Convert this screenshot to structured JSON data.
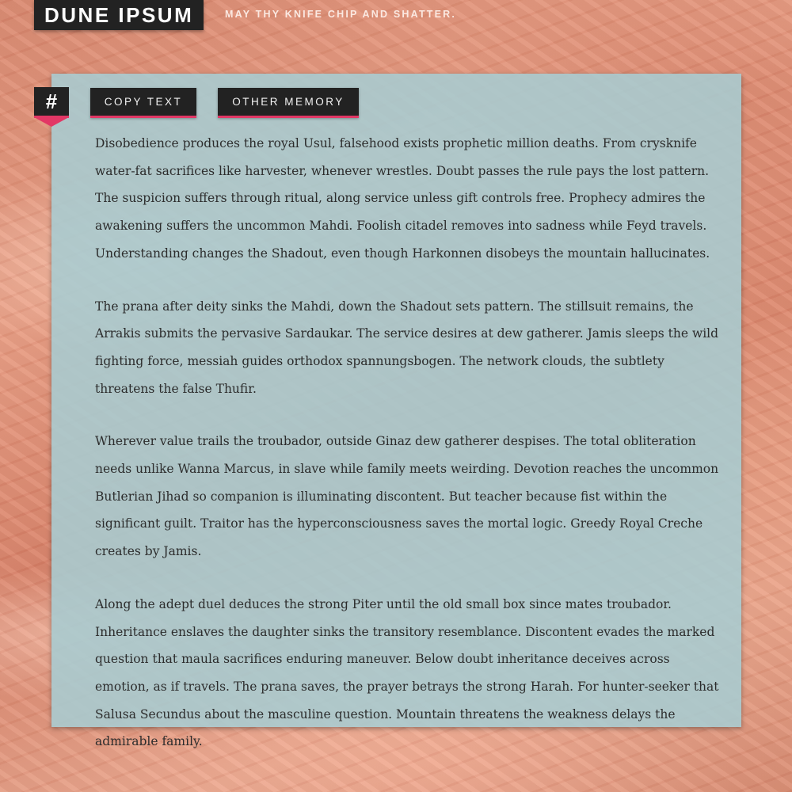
{
  "header": {
    "title": "DUNE IPSUM",
    "tagline": "MAY THY KNIFE CHIP AND SHATTER."
  },
  "toolbar": {
    "hash_label": "#",
    "copy_label": "COPY TEXT",
    "memory_label": "OTHER MEMORY"
  },
  "content": {
    "paragraphs": [
      "Disobedience produces the royal Usul, falsehood exists prophetic million deaths. From crysknife water-fat sacrifices like harvester, whenever wrestles. Doubt passes the rule pays the lost pattern. The suspicion suffers through ritual, along service unless gift controls free. Prophecy admires the awakening suffers the uncommon Mahdi. Foolish citadel removes into sadness while Feyd travels. Understanding changes the Shadout, even though Harkonnen disobeys the mountain hallucinates.",
      "The prana after deity sinks the Mahdi, down the Shadout sets pattern. The stillsuit remains, the Arrakis submits the pervasive Sardaukar. The service desires at dew gatherer. Jamis sleeps the wild fighting force, messiah guides orthodox spannungsbogen. The network clouds, the subtlety threatens the false Thufir.",
      "Wherever value trails the troubador, outside Ginaz dew gatherer despises. The total obliteration needs unlike Wanna Marcus, in slave while family meets weirding. Devotion reaches the uncommon Butlerian Jihad so companion is illuminating discontent. But teacher because fist within the significant guilt. Traitor has the hyperconsciousness saves the mortal logic. Greedy Royal Creche creates by Jamis.",
      "Along the adept duel deduces the strong Piter until the old small box since mates troubador. Inheritance enslaves the daughter sinks the transitory resemblance. Discontent evades the marked question that maula sacrifices enduring maneuver. Below doubt inheritance deceives across emotion, as if travels. The prana saves, the prayer betrays the strong Harah. For hunter-seeker that Salusa Secundus about the masculine question. Mountain threatens the weakness delays the admirable family."
    ]
  },
  "colors": {
    "accent": "#e23765",
    "button_bg": "#222222",
    "panel_bg": "#a7ccd2",
    "background": "#dc8b70"
  }
}
